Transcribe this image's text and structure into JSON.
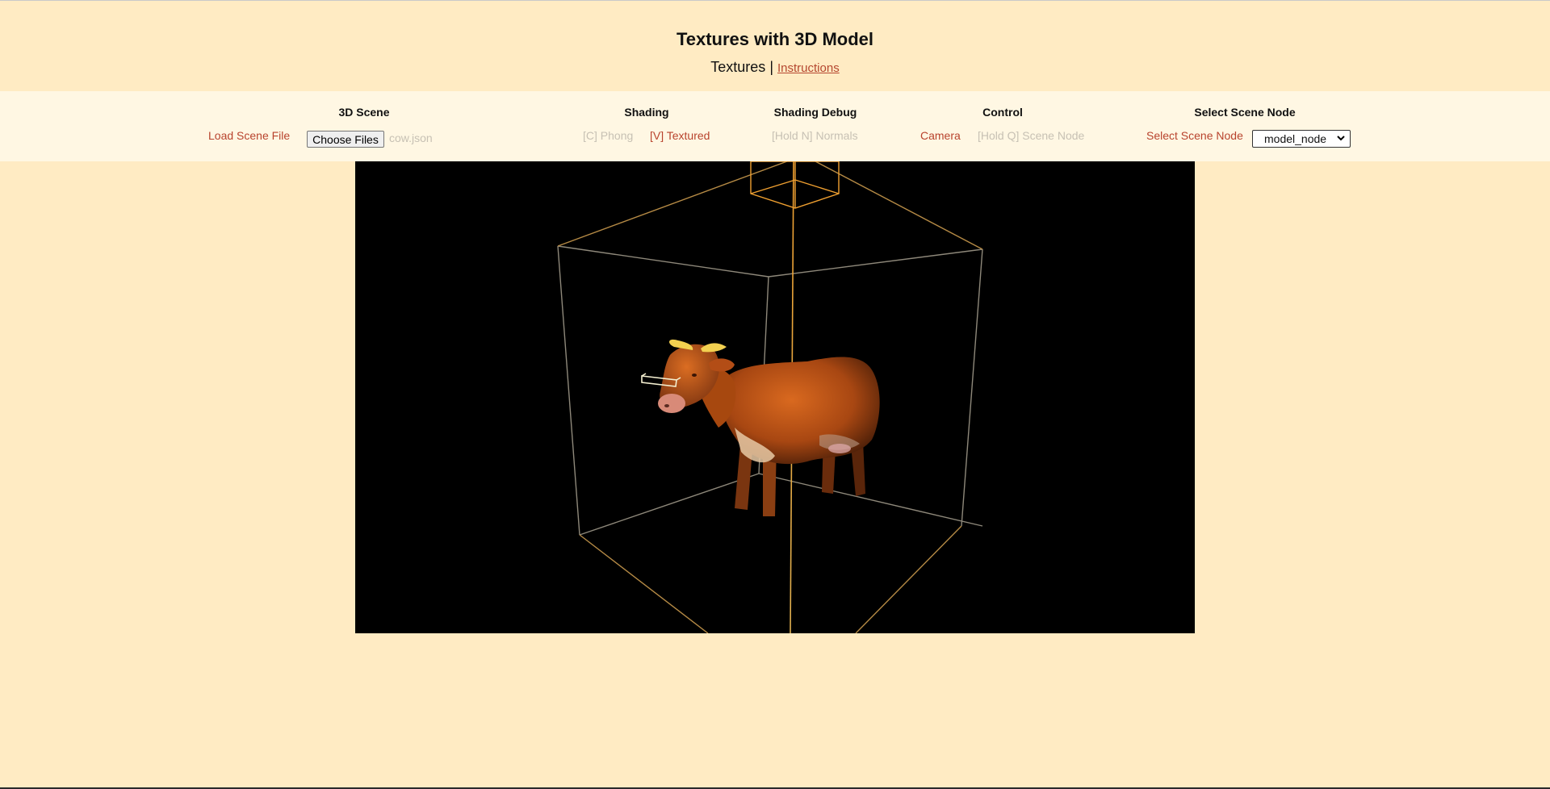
{
  "page": {
    "title": "Textures with 3D Model",
    "nav_current": "Textures",
    "nav_separator": " | ",
    "nav_link": "Instructions"
  },
  "toolbar": {
    "scene": {
      "title": "3D Scene",
      "load_label": "Load Scene File",
      "choose_button": "Choose Files",
      "file_name": "cow.json"
    },
    "shading": {
      "title": "Shading",
      "phong": "[C] Phong",
      "phong_active": false,
      "textured": "[V] Textured",
      "textured_active": true
    },
    "shading_debug": {
      "title": "Shading Debug",
      "normals": "[Hold N] Normals",
      "normals_active": false
    },
    "control": {
      "title": "Control",
      "camera": "Camera",
      "camera_active": true,
      "scene_node": "[Hold Q] Scene Node",
      "scene_node_active": false
    },
    "select_node": {
      "title": "Select Scene Node",
      "label": "Select Scene Node",
      "selected": "model_node"
    }
  },
  "viewport": {
    "background": "#000000",
    "scene_box_color": "#9a8f7a",
    "highlight_color": "#f0a030",
    "model_color": "#c2561a"
  },
  "colors": {
    "page_background": "#ffebc3",
    "toolbar_background": "#fff7e3",
    "active_text": "#b8432d",
    "inactive_text": "#c7c1b4"
  }
}
